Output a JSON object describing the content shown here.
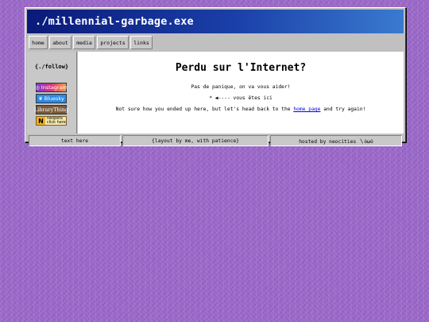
{
  "window": {
    "title": "./millennial-garbage.exe"
  },
  "nav": {
    "items": [
      "home",
      "about",
      "media",
      "projects",
      "links"
    ]
  },
  "sidebar": {
    "title": "{./follow}",
    "badges": {
      "instagram": "Instagram",
      "bluesky": "Bluesky",
      "librarything": "LibraryThing",
      "neopets": {
        "letter": "N",
        "line1": "neopets",
        "line2": "click here"
      }
    }
  },
  "main": {
    "title": "Perdu sur l'Internet?",
    "line1": "Pas de panique, on va vous aider!",
    "line2_marker": "*",
    "line2_text": "◀---- vous êtes ici",
    "line3_before": "Not sure how you ended up here, but let's head back to the ",
    "line3_link": "home page",
    "line3_after": " and try again!"
  },
  "footer": {
    "left": "text here",
    "center": "{layout by me, with patience}",
    "right": "hosted by neocities 〵òωó"
  },
  "colors": {
    "background": "#9a68c8",
    "titlebar_start": "#0a1a7a",
    "titlebar_end": "#3a7ad0",
    "link": "#0000ee"
  }
}
